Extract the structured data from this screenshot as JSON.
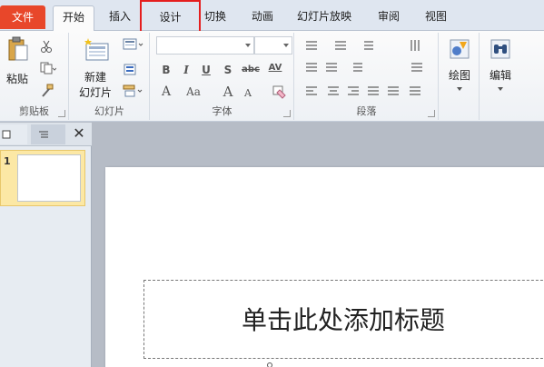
{
  "tabs": {
    "file": "文件",
    "home": "开始",
    "insert": "插入",
    "design": "设计",
    "transitions": "切换",
    "animations": "动画",
    "slideshow": "幻灯片放映",
    "review": "审阅",
    "view": "视图"
  },
  "ribbon": {
    "clipboard": {
      "paste_label": "粘贴",
      "group_label": "剪贴板"
    },
    "slides": {
      "new_label_line1": "新建",
      "new_label_line2": "幻灯片",
      "group_label": "幻灯片"
    },
    "font": {
      "group_label": "字体",
      "bold": "B",
      "italic": "I",
      "underline": "U",
      "shadow": "S",
      "strike": "abc",
      "spacing": "AV",
      "grow": "A",
      "shrink": "A",
      "case": "Aa",
      "color": "A"
    },
    "paragraph": {
      "group_label": "段落"
    },
    "drawing": {
      "label": "绘图"
    },
    "editing": {
      "label": "编辑"
    }
  },
  "pane": {
    "slide_number": "1"
  },
  "slide": {
    "title_placeholder": "单击此处添加标题"
  },
  "colors": {
    "file_tab": "#e8472a",
    "highlight_box": "#e51e1e",
    "ribbon_bg": "#fbfbfb",
    "editor_bg": "#b6bcc6"
  }
}
